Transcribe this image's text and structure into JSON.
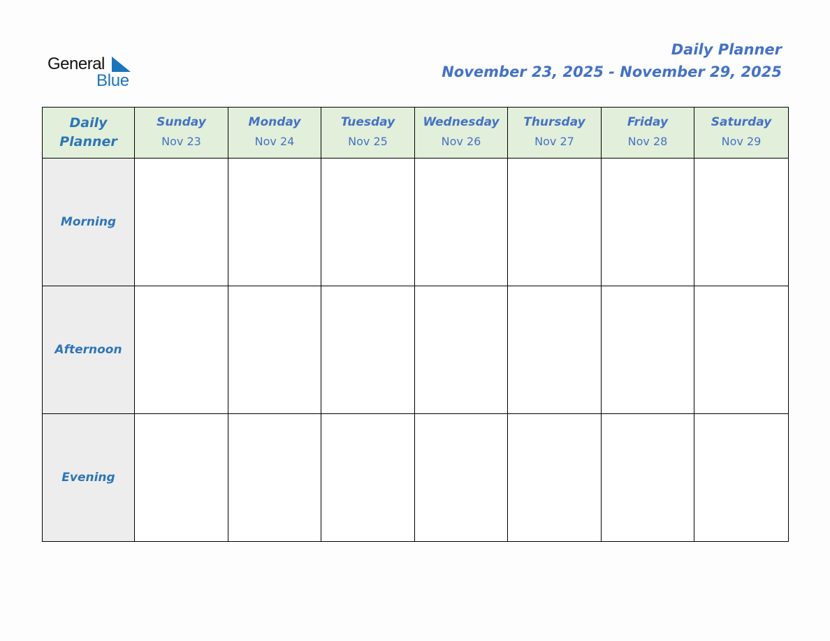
{
  "logo": {
    "word1": "General",
    "word2": "Blue",
    "icon": "triangle-flag-icon"
  },
  "header": {
    "title": "Daily Planner",
    "date_range": "November 23, 2025 - November 29, 2025"
  },
  "table": {
    "corner_label": [
      "Daily",
      "Planner"
    ],
    "days": [
      {
        "name": "Sunday",
        "date": "Nov 23"
      },
      {
        "name": "Monday",
        "date": "Nov 24"
      },
      {
        "name": "Tuesday",
        "date": "Nov 25"
      },
      {
        "name": "Wednesday",
        "date": "Nov 26"
      },
      {
        "name": "Thursday",
        "date": "Nov 27"
      },
      {
        "name": "Friday",
        "date": "Nov 28"
      },
      {
        "name": "Saturday",
        "date": "Nov 29"
      }
    ],
    "periods": [
      "Morning",
      "Afternoon",
      "Evening"
    ]
  },
  "colors": {
    "accent": "#4472c4",
    "period_text": "#2e75b6",
    "header_bg": "#e2efda",
    "period_bg": "#ededed",
    "logo_blue": "#1b75bb"
  }
}
